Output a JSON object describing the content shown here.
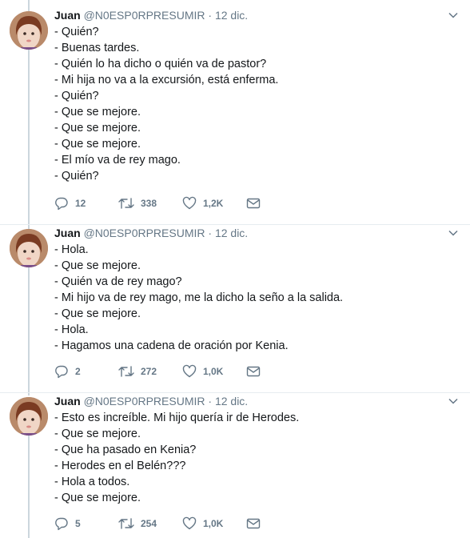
{
  "tweets": [
    {
      "name": "Juan",
      "handle": "@N0ESP0RPRESUMIR",
      "date": "· 12 dic.",
      "lines": [
        "- Quién?",
        "- Buenas tardes.",
        "- Quién lo ha dicho o quién va de pastor?",
        "- Mi hija no va a la excursión, está enferma.",
        "- Quién?",
        "- Que se mejore.",
        "- Que se mejore.",
        "- Que se mejore.",
        "- El mío va de rey mago.",
        "- Quién?"
      ],
      "replies": "12",
      "retweets": "338",
      "likes": "1,2K"
    },
    {
      "name": "Juan",
      "handle": "@N0ESP0RPRESUMIR",
      "date": "· 12 dic.",
      "lines": [
        "- Hola.",
        "- Que se mejore.",
        "- Quién va de rey mago?",
        "- Mi hijo va de rey mago, me la dicho la seño a la salida.",
        "- Que se mejore.",
        "- Hola.",
        "- Hagamos una cadena de oración por Kenia."
      ],
      "replies": "2",
      "retweets": "272",
      "likes": "1,0K"
    },
    {
      "name": "Juan",
      "handle": "@N0ESP0RPRESUMIR",
      "date": "· 12 dic.",
      "lines": [
        "- Esto es increíble. Mi hijo quería ir de Herodes.",
        "- Que se mejore.",
        "- Que ha pasado en Kenia?",
        "- Herodes en el Belén???",
        "- Hola a todos.",
        "- Que se mejore."
      ],
      "replies": "5",
      "retweets": "254",
      "likes": "1,0K"
    }
  ],
  "icons": {
    "reply": "reply-icon",
    "retweet": "retweet-icon",
    "like": "heart-icon",
    "dm": "envelope-icon",
    "caret": "chevron-down-icon"
  },
  "colors": {
    "text": "#14171a",
    "muted": "#657786",
    "thread_line": "#ccd6dd",
    "divider": "#e6ecf0"
  }
}
